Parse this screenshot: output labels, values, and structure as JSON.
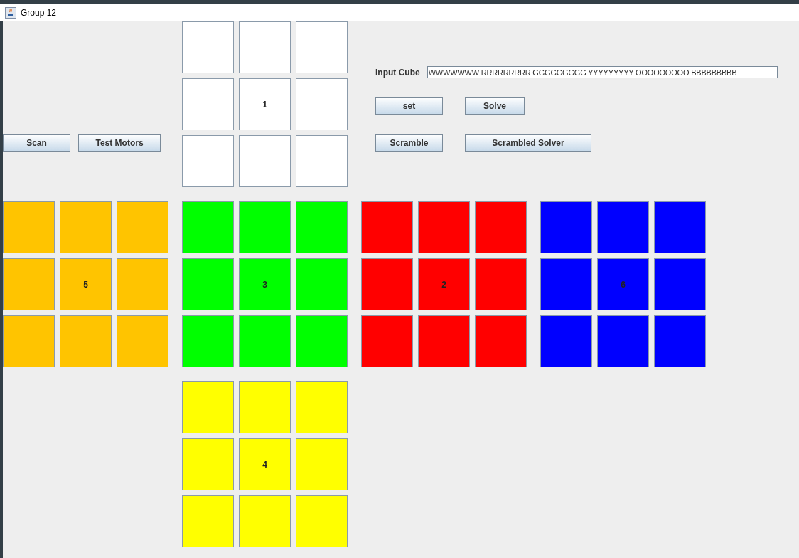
{
  "window": {
    "title": "Group 12"
  },
  "left_buttons": [
    "Scan",
    "Test Motors"
  ],
  "input": {
    "label": "Input Cube",
    "value": "WWWWWWW RRRRRRRRR GGGGGGGGG YYYYYYYYY OOOOOOOOO BBBBBBBBB"
  },
  "right_buttons": [
    [
      "set",
      "Solve"
    ],
    [
      "Scramble",
      "Scrambled Solver"
    ]
  ],
  "faces": [
    {
      "label": "1",
      "color": "#ffffff"
    },
    {
      "label": "5",
      "color": "#ffc400"
    },
    {
      "label": "3",
      "color": "#00ff00"
    },
    {
      "label": "2",
      "color": "#ff0000"
    },
    {
      "label": "6",
      "color": "#0000ff"
    },
    {
      "label": "4",
      "color": "#ffff00"
    }
  ]
}
